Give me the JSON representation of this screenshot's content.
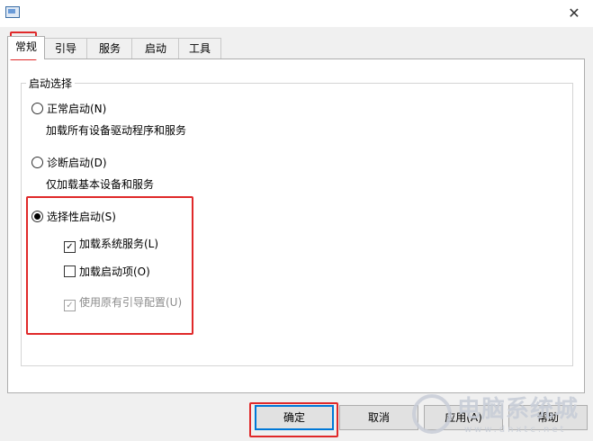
{
  "tabs": [
    "常规",
    "引导",
    "服务",
    "启动",
    "工具"
  ],
  "group_title": "启动选择",
  "options": {
    "normal": {
      "label": "正常启动(N)",
      "desc": "加载所有设备驱动程序和服务",
      "checked": false
    },
    "diagnostic": {
      "label": "诊断启动(D)",
      "desc": "仅加载基本设备和服务",
      "checked": false
    },
    "selective": {
      "label": "选择性启动(S)",
      "checked": true
    }
  },
  "sub_options": {
    "system_services": {
      "label": "加载系统服务(L)",
      "checked": true
    },
    "startup_items": {
      "label": "加载启动项(O)",
      "checked": false
    },
    "original_boot": {
      "label": "使用原有引导配置(U)",
      "checked": true,
      "disabled": true
    }
  },
  "buttons": {
    "ok": "确定",
    "cancel": "取消",
    "apply": "应用(A)",
    "help": "帮助"
  },
  "icons": {
    "close": "close-icon",
    "app": "msconfig-icon"
  },
  "watermark": {
    "text": "电脑系统城",
    "url": "www.dnxtc.net"
  },
  "colors": {
    "highlight": "#e0292a",
    "focus": "#0078d7"
  }
}
